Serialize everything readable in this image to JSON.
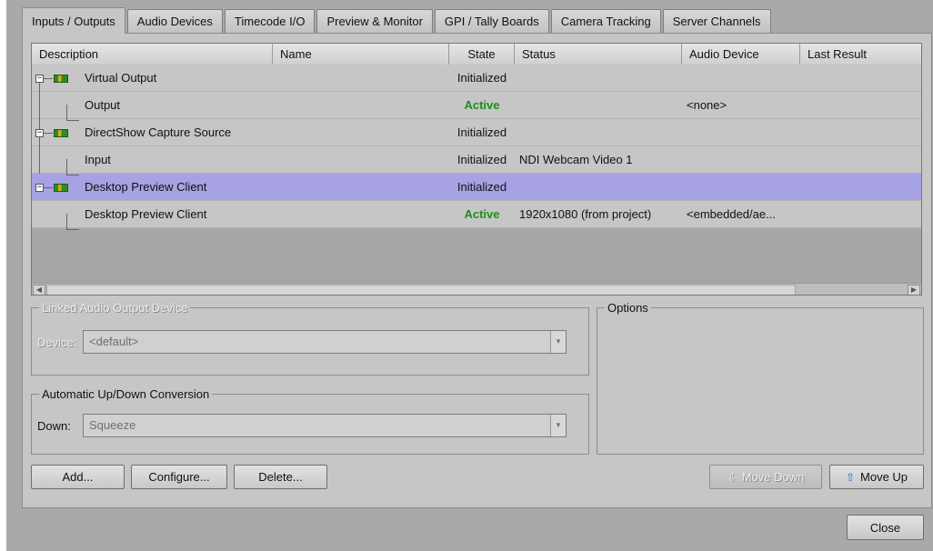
{
  "tabs": [
    "Inputs / Outputs",
    "Audio Devices",
    "Timecode I/O",
    "Preview & Monitor",
    "GPI / Tally Boards",
    "Camera Tracking",
    "Server Channels"
  ],
  "grid": {
    "columns": [
      "Description",
      "Name",
      "State",
      "Status",
      "Audio Device",
      "Last Result"
    ],
    "rows": [
      {
        "description": "Virtual Output",
        "state": "Initialized",
        "status": "",
        "audio": ""
      },
      {
        "description": "Output",
        "state": "Active",
        "status": "",
        "audio": "<none>"
      },
      {
        "description": "DirectShow Capture Source",
        "state": "Initialized",
        "status": "",
        "audio": ""
      },
      {
        "description": "Input",
        "state": "Initialized",
        "status": "NDI Webcam Video 1",
        "audio": ""
      },
      {
        "description": "Desktop Preview Client",
        "state": "Initialized",
        "status": "",
        "audio": ""
      },
      {
        "description": "Desktop Preview Client",
        "state": "Active",
        "status": "1920x1080 (from project)",
        "audio": "<embedded/ae..."
      }
    ]
  },
  "linked_audio": {
    "legend": "Linked Audio Output Device",
    "device_label": "Device:",
    "device_value": "<default>"
  },
  "conversion": {
    "legend": "Automatic Up/Down Conversion",
    "down_label": "Down:",
    "down_value": "Squeeze"
  },
  "options": {
    "legend": "Options"
  },
  "buttons": {
    "add": "Add...",
    "configure": "Configure...",
    "delete": "Delete...",
    "move_down": "Move Down",
    "move_up": "Move Up",
    "close": "Close"
  },
  "colors": {
    "active_state": "#1c8f1c",
    "selected_row": "#a7a2e3"
  }
}
